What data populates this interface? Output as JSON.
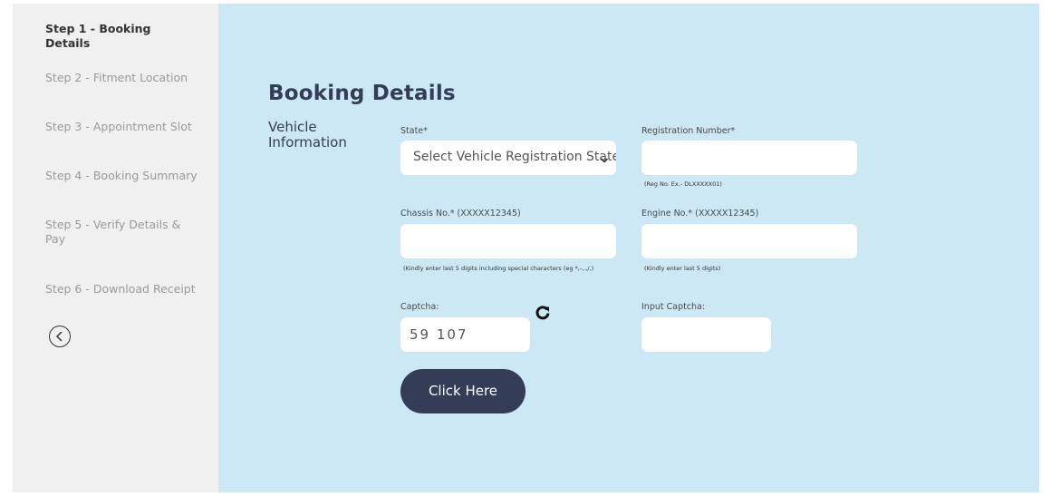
{
  "sidebar": {
    "steps": [
      {
        "label": "Step 1 - Booking Details"
      },
      {
        "label": "Step 2 - Fitment Location"
      },
      {
        "label": "Step 3 - Appointment Slot"
      },
      {
        "label": "Step 4 - Booking Summary"
      },
      {
        "label": "Step 5 - Verify Details & Pay"
      },
      {
        "label": "Step 6 - Download Receipt"
      }
    ],
    "active_step": 1,
    "back_icon": "chevron-left-circle-icon"
  },
  "main": {
    "title": "Booking Details",
    "section_label": "Vehicle Information",
    "state": {
      "label": "State*",
      "value": "Select Vehicle Registration State"
    },
    "registration": {
      "label": "Registration Number*",
      "value": "",
      "hint": "(Reg No. Ex.- DLXXXXX01)"
    },
    "chassis": {
      "label": "Chassis No.* (XXXXX12345)",
      "value": "",
      "hint": "(Kindly enter last 5 digits including special characters (eg *,-,.,/,)"
    },
    "engine": {
      "label": "Engine No.* (XXXXX12345)",
      "value": "",
      "hint": "(Kindly enter last 5 digits)"
    },
    "captcha": {
      "label": "Captcha:",
      "value": "59 107",
      "refresh_icon": "refresh-icon"
    },
    "input_captcha": {
      "label": "Input Captcha:",
      "value": ""
    },
    "submit_label": "Click Here"
  },
  "colors": {
    "sidebar_bg": "#f0f0f0",
    "main_bg": "#cce8f4",
    "primary": "#343d57"
  }
}
